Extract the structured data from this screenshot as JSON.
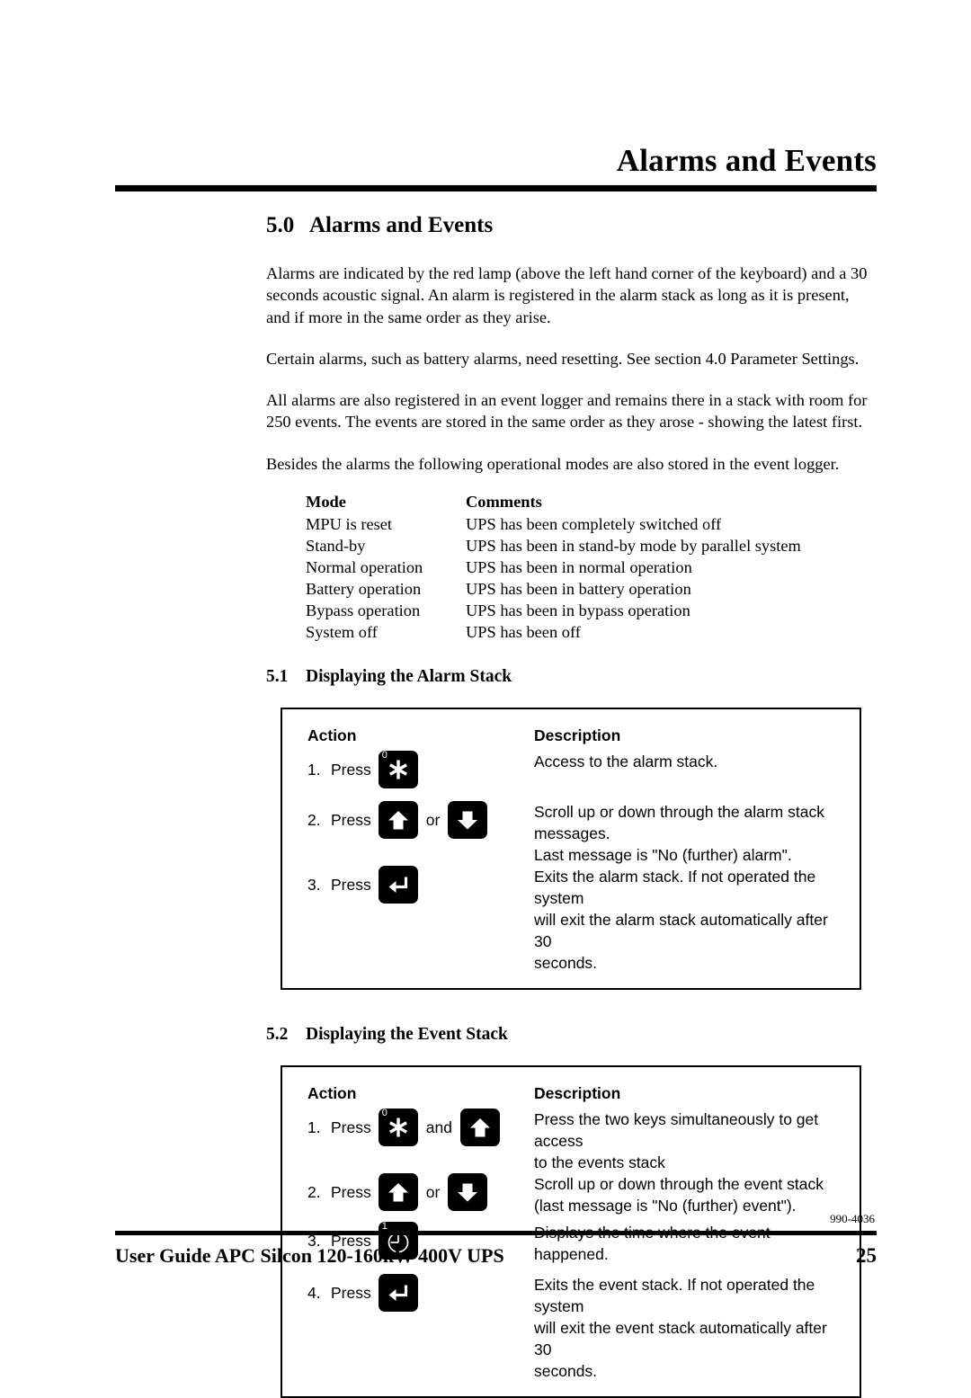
{
  "header": {
    "title": "Alarms and Events"
  },
  "section": {
    "number": "5.0",
    "title": "Alarms and Events",
    "paragraphs": [
      "Alarms are indicated by the red lamp (above the left hand corner of the keyboard) and a 30 seconds acoustic signal. An alarm is registered in the alarm stack as long as it is present, and if more in the same order as they arise.",
      "Certain alarms, such as battery alarms, need resetting. See section 4.0 Parameter Settings.",
      "All alarms are also registered in an event logger and remains there in a stack with room for 250 events. The events are stored in the same order as they arose - showing the latest first.",
      "Besides the alarms the following operational modes are also stored in the event logger."
    ]
  },
  "mode_table": {
    "headers": [
      "Mode",
      "Comments"
    ],
    "rows": [
      [
        "MPU is reset",
        "UPS has been completely switched off"
      ],
      [
        "Stand-by",
        "UPS has been in stand-by mode by parallel system"
      ],
      [
        "Normal operation",
        "UPS has been in normal operation"
      ],
      [
        "Battery operation",
        "UPS has been in battery operation"
      ],
      [
        "Bypass operation",
        "UPS has been in bypass operation"
      ],
      [
        "System off",
        "UPS has been off"
      ]
    ]
  },
  "alarm_stack": {
    "number": "5.1",
    "title": "Displaying the Alarm Stack",
    "headers": {
      "action": "Action",
      "description": "Description"
    },
    "press_label": "Press",
    "steps": [
      {
        "num": "1.",
        "keys": [
          {
            "icon": "asterisk-key-icon",
            "corner": "0"
          }
        ],
        "conjunction": "",
        "description": [
          "Access to the alarm stack."
        ]
      },
      {
        "num": "2.",
        "keys": [
          {
            "icon": "arrow-up-key-icon",
            "corner": ""
          },
          {
            "icon": "arrow-down-key-icon",
            "corner": ""
          }
        ],
        "conjunction": "or",
        "description": [
          "Scroll up or down through the alarm stack",
          "messages.",
          "Last message is \"No (further) alarm\"."
        ]
      },
      {
        "num": "3.",
        "keys": [
          {
            "icon": "enter-key-icon",
            "corner": ""
          }
        ],
        "conjunction": "",
        "description": [
          "Exits the alarm stack. If not operated the system",
          "will exit the alarm stack automatically after 30",
          "seconds."
        ]
      }
    ]
  },
  "event_stack": {
    "number": "5.2",
    "title": "Displaying the Event Stack",
    "headers": {
      "action": "Action",
      "description": "Description"
    },
    "press_label": "Press",
    "steps": [
      {
        "num": "1.",
        "keys": [
          {
            "icon": "asterisk-key-icon",
            "corner": "0"
          },
          {
            "icon": "arrow-up-key-icon",
            "corner": ""
          }
        ],
        "conjunction": "and",
        "description": [
          "Press the two keys simultaneously to get access",
          "to the events stack"
        ]
      },
      {
        "num": "2.",
        "keys": [
          {
            "icon": "arrow-up-key-icon",
            "corner": ""
          },
          {
            "icon": "arrow-down-key-icon",
            "corner": ""
          }
        ],
        "conjunction": "or",
        "description": [
          "Scroll up or down through the event stack",
          "(last message is \"No (further) event\")."
        ]
      },
      {
        "num": "3.",
        "keys": [
          {
            "icon": "clock-key-icon",
            "corner": "1"
          }
        ],
        "conjunction": "",
        "description": [
          "Displays the time where the event happened."
        ]
      },
      {
        "num": "4.",
        "keys": [
          {
            "icon": "enter-key-icon",
            "corner": ""
          }
        ],
        "conjunction": "",
        "description": [
          "Exits the event stack. If not operated the system",
          "will exit the event stack automatically after 30",
          "seconds."
        ]
      }
    ]
  },
  "footer": {
    "doc_code": "990-4036",
    "guide_title": "User Guide APC Silcon 120-160kW 400V UPS",
    "page_number": "25"
  }
}
